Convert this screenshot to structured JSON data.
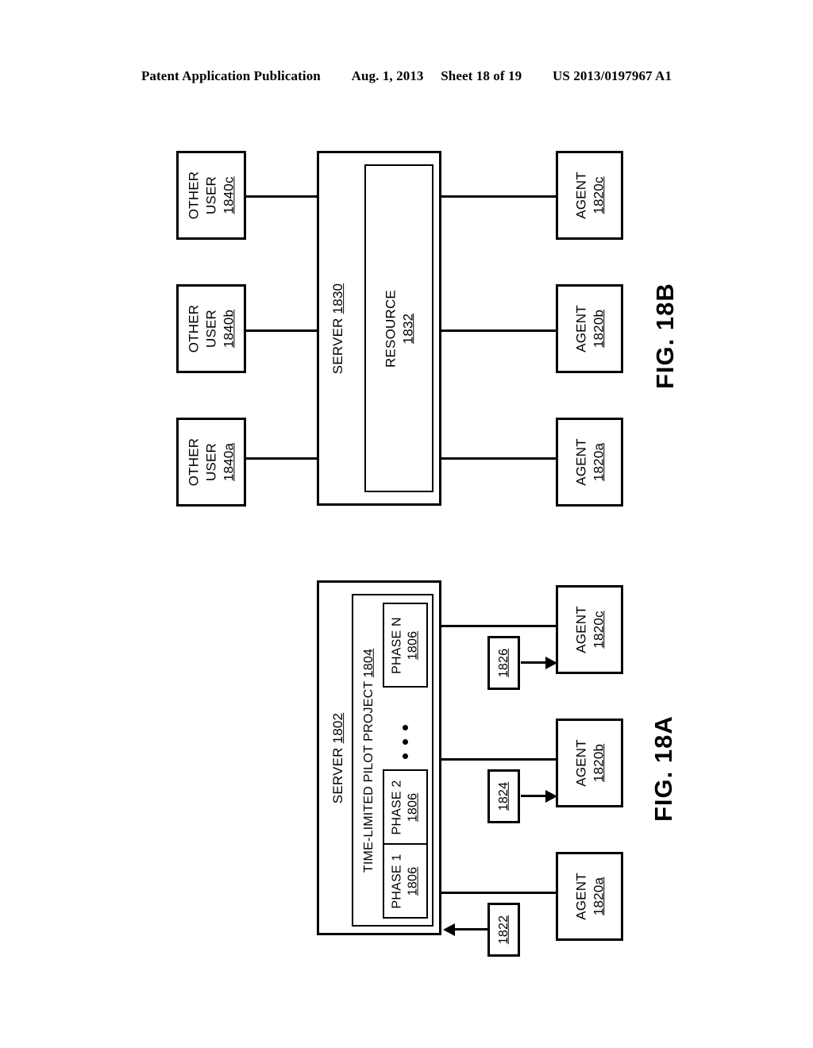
{
  "header": {
    "publication": "Patent Application Publication",
    "date": "Aug. 1, 2013",
    "sheet": "Sheet 18 of 19",
    "docnum": "US 2013/0197967 A1"
  },
  "fig18b": {
    "caption": "FIG. 18B",
    "server": {
      "label": "SERVER",
      "ref": "1830",
      "resource": {
        "label": "RESOURCE",
        "ref": "1832"
      }
    },
    "other_users": [
      {
        "label_line1": "OTHER",
        "label_line2": "USER",
        "ref": "1840a"
      },
      {
        "label_line1": "OTHER",
        "label_line2": "USER",
        "ref": "1840b"
      },
      {
        "label_line1": "OTHER",
        "label_line2": "USER",
        "ref": "1840c"
      }
    ],
    "agents": [
      {
        "label": "AGENT",
        "ref": "1820a"
      },
      {
        "label": "AGENT",
        "ref": "1820b"
      },
      {
        "label": "AGENT",
        "ref": "1820c"
      }
    ]
  },
  "fig18a": {
    "caption": "FIG. 18A",
    "server": {
      "label": "SERVER",
      "ref": "1802",
      "project": {
        "label": "TIME-LIMITED PILOT PROJECT",
        "ref": "1804",
        "phases": [
          {
            "label": "PHASE 1",
            "ref": "1806"
          },
          {
            "label": "PHASE 2",
            "ref": "1806"
          },
          {
            "label": "PHASE N",
            "ref": "1806"
          }
        ],
        "ellipsis": "..."
      }
    },
    "agents": [
      {
        "label": "AGENT",
        "ref": "1820a"
      },
      {
        "label": "AGENT",
        "ref": "1820b"
      },
      {
        "label": "AGENT",
        "ref": "1820c"
      }
    ],
    "messages": [
      {
        "ref": "1822",
        "direction": "left"
      },
      {
        "ref": "1824",
        "direction": "right"
      },
      {
        "ref": "1826",
        "direction": "right"
      }
    ]
  }
}
